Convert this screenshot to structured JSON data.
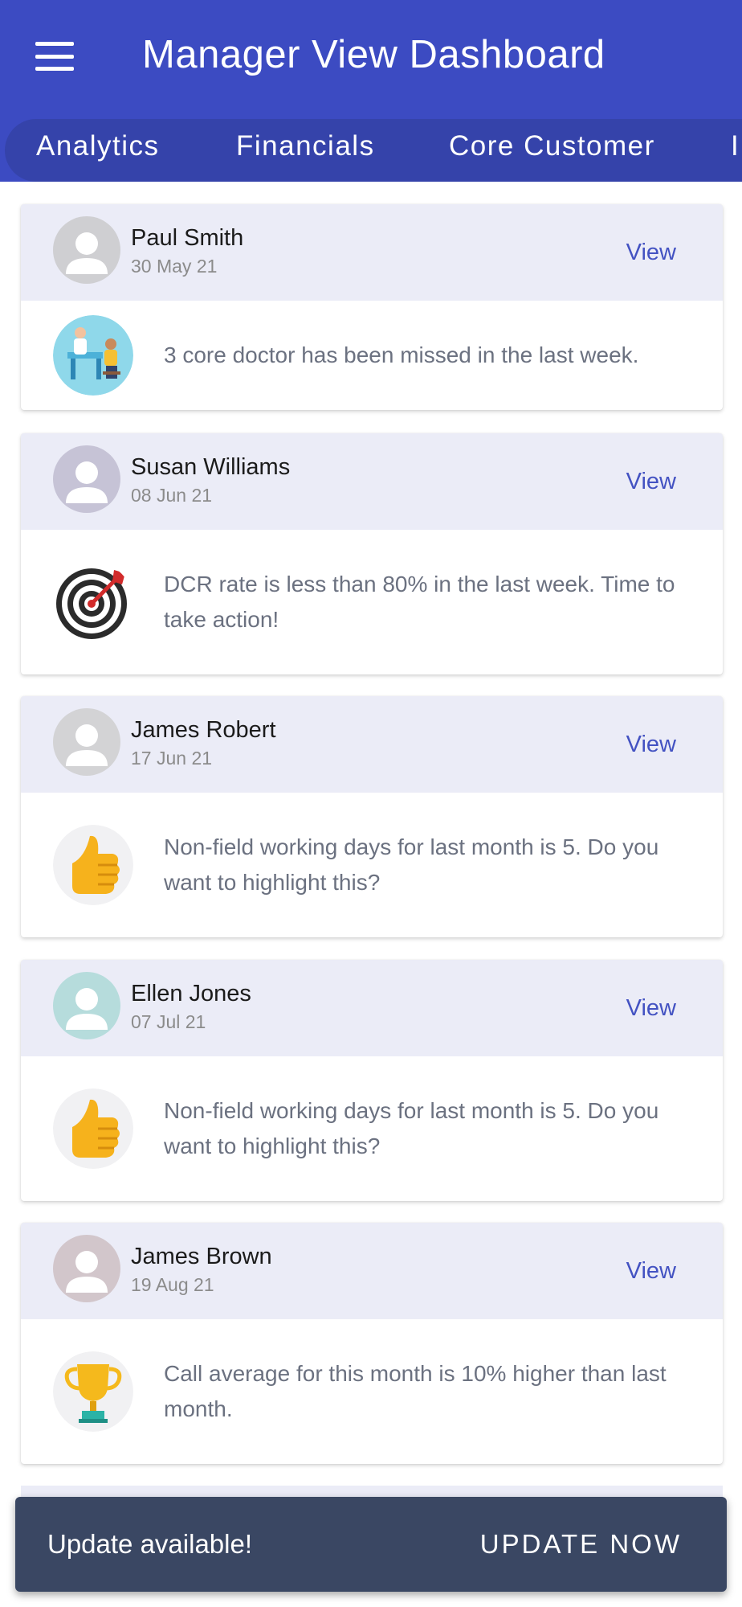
{
  "header": {
    "title": "Manager View Dashboard",
    "menu_icon": "hamburger-menu-icon",
    "background": "#3c4bc2"
  },
  "tabs": [
    {
      "label": "Analytics"
    },
    {
      "label": "Financials"
    },
    {
      "label": "Core Customer"
    },
    {
      "label": "I"
    }
  ],
  "feed": [
    {
      "name": "Paul Smith",
      "date": "30 May 21",
      "action": "View",
      "icon": "doctor-visit-icon",
      "message": "3 core doctor has been missed in the last week.",
      "avatar_color": "#cfcfd2"
    },
    {
      "name": "Susan Williams",
      "date": "08 Jun 21",
      "action": "View",
      "icon": "target-dart-icon",
      "message": "DCR rate is less than 80% in the last week. Time to take action!",
      "avatar_color": "#c6c3d6"
    },
    {
      "name": "James Robert",
      "date": "17 Jun 21",
      "action": "View",
      "icon": "thumbs-up-icon",
      "message": "Non-field working days for last month is 5. Do you want to highlight this?",
      "avatar_color": "#d3d3d5"
    },
    {
      "name": "Ellen Jones",
      "date": "07 Jul 21",
      "action": "View",
      "icon": "thumbs-up-icon",
      "message": "Non-field working days for last month is 5. Do you want to highlight this?",
      "avatar_color": "#b6dcdc"
    },
    {
      "name": "James Brown",
      "date": "19 Aug 21",
      "action": "View",
      "icon": "trophy-icon",
      "message": "Call average for this month is 10% higher than last month.",
      "avatar_color": "#d2c6cb"
    }
  ],
  "snackbar": {
    "text": "Update available!",
    "action": "UPDATE NOW"
  }
}
